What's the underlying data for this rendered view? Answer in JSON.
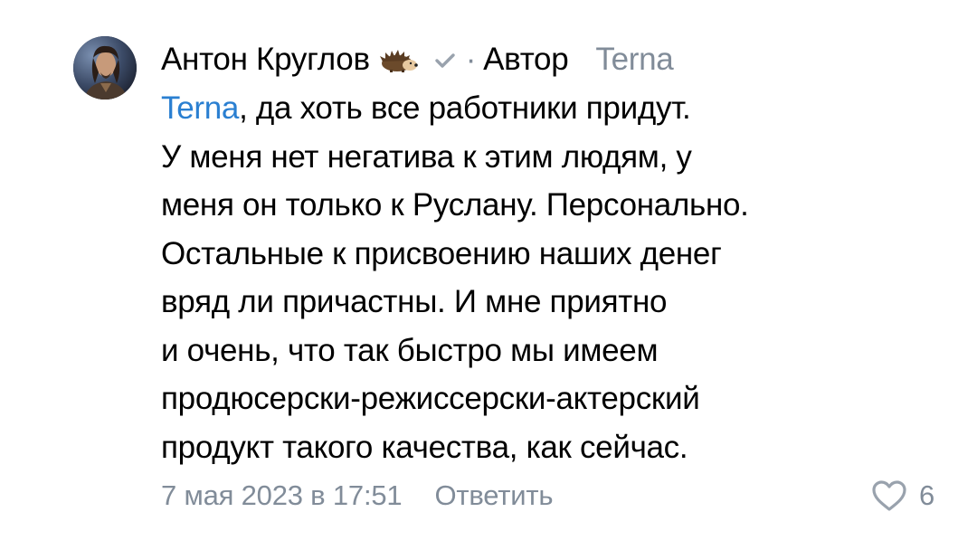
{
  "comment": {
    "author_name": "Антон Круглов",
    "author_emoji_icon": "hedgehog-icon",
    "verified_icon": "checkmark-icon",
    "separator": "·",
    "author_badge": "Автор",
    "reply_to": "Terna",
    "mention": "Terna",
    "text_lines": [
      ", да хоть все работники придут.",
      "У меня нет негатива к этим людям, у",
      "меня он только к Руслану. Персонально.",
      "Остальные к присвоению наших денег",
      "вряд ли причастны. И мне приятно",
      "и очень, что так быстро мы имеем",
      "продюсерски-режиссерски-актерский",
      "продукт такого качества, как сейчас."
    ],
    "date": "7 мая 2023 в 17:51",
    "reply_label": "Ответить",
    "like_icon": "heart-icon",
    "like_count": "6"
  },
  "colors": {
    "link": "#2a7fd1",
    "secondary": "#818c99",
    "text": "#000000"
  }
}
